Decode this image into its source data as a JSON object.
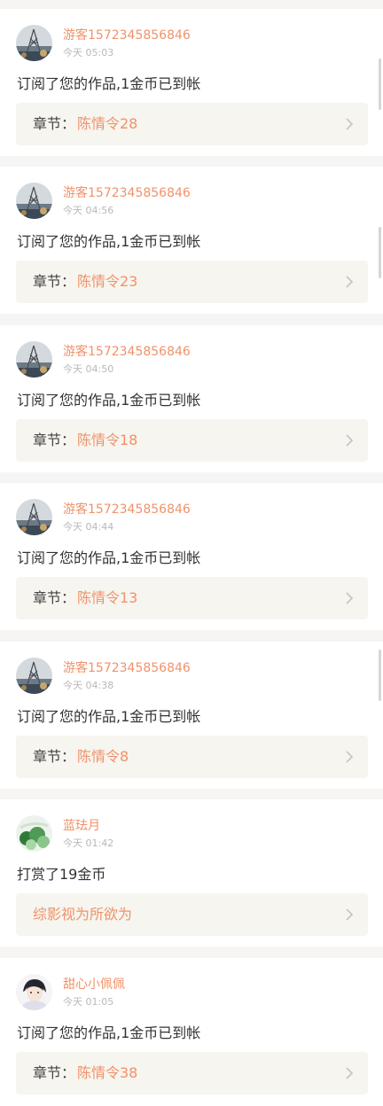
{
  "colors": {
    "accent": "#f0926a",
    "page_background": "#f7f4f4",
    "card_background": "#ffffff",
    "link_background": "#f6f5ef",
    "text": "#333333",
    "muted": "#b9b9b9"
  },
  "feed": {
    "chapter_prefix": "章节：",
    "items": [
      {
        "avatar": "landscape-avatar",
        "username": "游客1572345856846",
        "time": "今天 05:03",
        "message": "订阅了您的作品,1金币已到帐",
        "chapter": "陈情令28",
        "arrow_icon": "chevron-right-icon"
      },
      {
        "avatar": "landscape-avatar",
        "username": "游客1572345856846",
        "time": "今天 04:56",
        "message": "订阅了您的作品,1金币已到帐",
        "chapter": "陈情令23",
        "arrow_icon": "chevron-right-icon"
      },
      {
        "avatar": "landscape-avatar",
        "username": "游客1572345856846",
        "time": "今天 04:50",
        "message": "订阅了您的作品,1金币已到帐",
        "chapter": "陈情令18",
        "arrow_icon": "chevron-right-icon"
      },
      {
        "avatar": "landscape-avatar",
        "username": "游客1572345856846",
        "time": "今天 04:44",
        "message": "订阅了您的作品,1金币已到帐",
        "chapter": "陈情令13",
        "arrow_icon": "chevron-right-icon"
      },
      {
        "avatar": "landscape-avatar",
        "username": "游客1572345856846",
        "time": "今天 04:38",
        "message": "订阅了您的作品,1金币已到帐",
        "chapter": "陈情令8",
        "arrow_icon": "chevron-right-icon"
      },
      {
        "avatar": "plant-avatar",
        "username": "蓝珐月",
        "time": "今天 01:42",
        "message": "打赏了19金币",
        "work": "综影视为所欲为",
        "arrow_icon": "chevron-right-icon"
      },
      {
        "avatar": "portrait-avatar",
        "username": "甜心小佩佩",
        "time": "今天 01:05",
        "message": "订阅了您的作品,1金币已到帐",
        "chapter": "陈情令38",
        "arrow_icon": "chevron-right-icon"
      }
    ]
  }
}
